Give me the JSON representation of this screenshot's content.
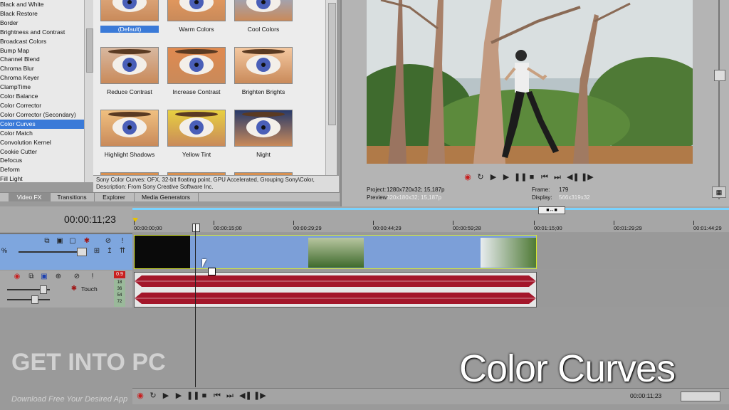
{
  "fx_list": {
    "items": [
      "Black and White",
      "Black Restore",
      "Border",
      "Brightness and Contrast",
      "Broadcast Colors",
      "Bump Map",
      "Channel Blend",
      "Chroma Blur",
      "Chroma Keyer",
      "ClampTime",
      "Color Balance",
      "Color Corrector",
      "Color Corrector (Secondary)",
      "Color Curves",
      "Color Match",
      "Convolution Kernel",
      "Cookie Cutter",
      "Defocus",
      "Deform",
      "Fill Light"
    ],
    "selected_index": 13
  },
  "presets": [
    {
      "label": "(Default)",
      "selected": true
    },
    {
      "label": "Warm Colors"
    },
    {
      "label": "Cool Colors"
    },
    {
      "label": "Reduce Contrast"
    },
    {
      "label": "Increase Contrast"
    },
    {
      "label": "Brighten Brights"
    },
    {
      "label": "Highlight Shadows"
    },
    {
      "label": "Yellow Tint"
    },
    {
      "label": "Night"
    }
  ],
  "description": {
    "line1": "Sony Color Curves: OFX, 32-bit floating point, GPU Accelerated, Grouping Sony\\Color,",
    "line2": "Description: From Sony Creative Software Inc."
  },
  "tabs": [
    "Video FX",
    "Transitions",
    "Explorer",
    "Media Generators"
  ],
  "preview": {
    "project_label": "Project:",
    "project_value": "1280x720x32; 15,187p",
    "preview_label": "Preview:",
    "preview_value": "320x180x32; 15,187p",
    "frame_label": "Frame:",
    "frame_value": "179",
    "display_label": "Display:",
    "display_value": "566x319x32"
  },
  "timeline": {
    "timecode": "00:00:11;23",
    "ruler_ticks": [
      "00:00:00;00",
      "00:00:15;00",
      "00:00:29;29",
      "00:00:44;29",
      "00:00:59;28",
      "00:01:15;00",
      "00:01:29;29",
      "00:01:44;29"
    ],
    "video_track_opacity_label": "%",
    "audio_touch_label": "Touch",
    "audio_level": "0.9",
    "meter_values": [
      "18",
      "36",
      "54",
      "72"
    ],
    "region_marker": "■↔■",
    "bottom_timecode": "00:00:11;23"
  },
  "overlay_title": "Color Curves",
  "watermark": {
    "title": "GET INTO PC",
    "subtitle": "Download Free Your Desired App"
  }
}
